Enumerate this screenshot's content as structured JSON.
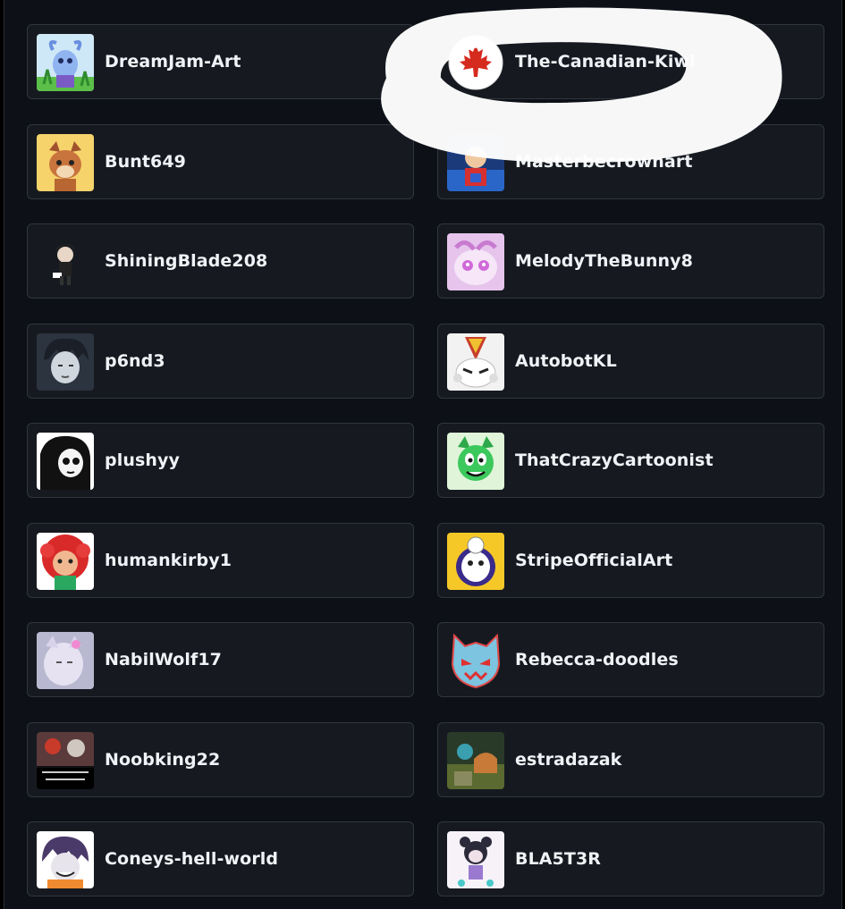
{
  "users": [
    {
      "name": "DreamJam-Art",
      "avatar_icon": "avatar-icon"
    },
    {
      "name": "The-Canadian-Kiwi",
      "avatar_icon": "canada-flag-icon"
    },
    {
      "name": "Bunt649",
      "avatar_icon": "avatar-icon"
    },
    {
      "name": "Masterbecrownart",
      "avatar_icon": "avatar-icon"
    },
    {
      "name": "ShiningBlade208",
      "avatar_icon": "avatar-icon"
    },
    {
      "name": "MelodyTheBunny8",
      "avatar_icon": "avatar-icon"
    },
    {
      "name": "p6nd3",
      "avatar_icon": "avatar-icon"
    },
    {
      "name": "AutobotKL",
      "avatar_icon": "avatar-icon"
    },
    {
      "name": "plushyy",
      "avatar_icon": "avatar-icon"
    },
    {
      "name": "ThatCrazyCartoonist",
      "avatar_icon": "avatar-icon"
    },
    {
      "name": "humankirby1",
      "avatar_icon": "avatar-icon"
    },
    {
      "name": "StripeOfficialArt",
      "avatar_icon": "avatar-icon"
    },
    {
      "name": "NabilWolf17",
      "avatar_icon": "avatar-icon"
    },
    {
      "name": "Rebecca-doodles",
      "avatar_icon": "avatar-icon"
    },
    {
      "name": "Noobking22",
      "avatar_icon": "avatar-icon"
    },
    {
      "name": "estradazak",
      "avatar_icon": "avatar-icon"
    },
    {
      "name": "Coneys-hell-world",
      "avatar_icon": "avatar-icon"
    },
    {
      "name": "BLA5T3R",
      "avatar_icon": "avatar-icon"
    }
  ],
  "colors": {
    "background": "#0d1117",
    "card": "#161a20",
    "border": "#30363d",
    "text": "#f0f3f6",
    "highlight_scribble": "#ffffff"
  }
}
